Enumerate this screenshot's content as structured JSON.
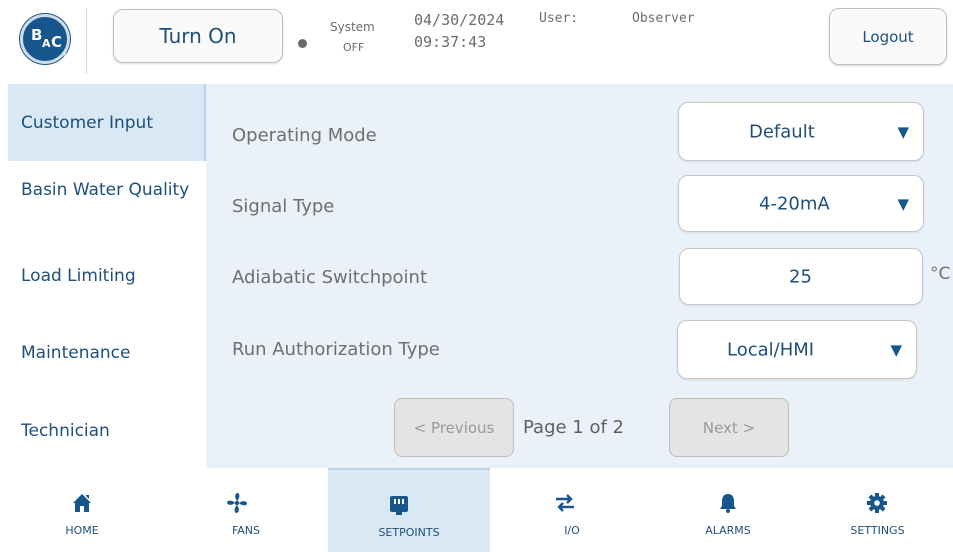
{
  "header": {
    "logo_text": {
      "b": "B",
      "a": "A",
      "c": "C",
      "r": "®"
    },
    "turn_on_label": "Turn On",
    "system_label": "System",
    "system_state": "OFF",
    "date": "04/30/2024",
    "time": "09:37:43",
    "user_label": "User:",
    "user_name": "Observer",
    "logout_label": "Logout"
  },
  "sidebar": {
    "items": [
      {
        "label": "Customer Input",
        "active": true
      },
      {
        "label": "Basin Water Quality",
        "active": false
      },
      {
        "label": "Load Limiting",
        "active": false
      },
      {
        "label": "Maintenance",
        "active": false
      },
      {
        "label": "Technician",
        "active": false
      }
    ]
  },
  "main": {
    "rows": [
      {
        "label": "Operating Mode",
        "value": "Default",
        "control": "dropdown"
      },
      {
        "label": "Signal Type",
        "value": "4-20mA",
        "control": "dropdown"
      },
      {
        "label": "Adiabatic Switchpoint",
        "value": "25",
        "control": "input",
        "unit": "°C"
      },
      {
        "label": "Run Authorization Type",
        "value": "Local/HMI",
        "control": "dropdown"
      }
    ],
    "dropdown_arrow": "▼",
    "pagination": {
      "previous_label": "< Previous",
      "page_info": "Page 1 of 2",
      "next_label": "Next >"
    }
  },
  "bottom_nav": {
    "items": [
      {
        "label": "HOME",
        "icon": "home-icon",
        "active": false
      },
      {
        "label": "FANS",
        "icon": "fan-icon",
        "active": false
      },
      {
        "label": "SETPOINTS",
        "icon": "setpoints-icon",
        "active": true
      },
      {
        "label": "I/O",
        "icon": "io-arrows-icon",
        "active": false
      },
      {
        "label": "ALARMS",
        "icon": "bell-icon",
        "active": false
      },
      {
        "label": "SETTINGS",
        "icon": "gear-icon",
        "active": false
      }
    ]
  },
  "colors": {
    "brand_blue": "#16568c",
    "text_blue": "#1f4f7a",
    "panel_bg": "#eaf1f8",
    "active_bg": "#d8e8f5"
  }
}
